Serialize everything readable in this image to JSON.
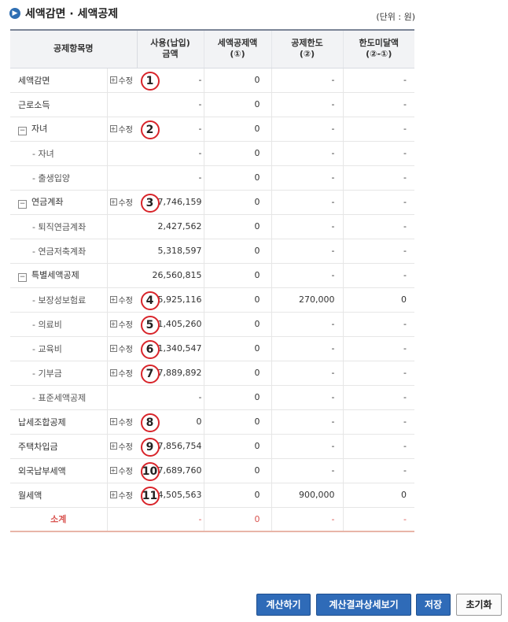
{
  "header": {
    "title": "세액감면 · 세액공제",
    "unit": "(단위 : 원)"
  },
  "columns": {
    "item": "공제항목명",
    "amount": [
      "사용(납입)",
      "금액"
    ],
    "credit": [
      "세액공제액",
      "(①)"
    ],
    "limit": [
      "공제한도",
      "(②)"
    ],
    "shortfall": [
      "한도미달액",
      "(②-①)"
    ]
  },
  "edit_label": "수정",
  "rows": [
    {
      "name": "세액감면",
      "level": "top",
      "edit": true,
      "marker": "1",
      "amount": "-",
      "credit": "0",
      "limit": "-",
      "shortfall": "-"
    },
    {
      "name": "근로소득",
      "level": "top",
      "edit": false,
      "marker": "",
      "amount": "-",
      "credit": "0",
      "limit": "-",
      "shortfall": "-"
    },
    {
      "name": "자녀",
      "level": "group",
      "edit": true,
      "marker": "2",
      "amount": "-",
      "credit": "0",
      "limit": "-",
      "shortfall": "-"
    },
    {
      "name": "- 자녀",
      "level": "sub",
      "edit": false,
      "marker": "",
      "amount": "-",
      "credit": "0",
      "limit": "-",
      "shortfall": "-"
    },
    {
      "name": "- 출생입양",
      "level": "sub",
      "edit": false,
      "marker": "",
      "amount": "-",
      "credit": "0",
      "limit": "-",
      "shortfall": "-"
    },
    {
      "name": "연금계좌",
      "level": "group",
      "edit": true,
      "marker": "3",
      "amount": "7,746,159",
      "credit": "0",
      "limit": "-",
      "shortfall": "-"
    },
    {
      "name": "- 퇴직연금계좌",
      "level": "sub",
      "edit": false,
      "marker": "",
      "amount": "2,427,562",
      "credit": "0",
      "limit": "-",
      "shortfall": "-"
    },
    {
      "name": "- 연금저축계좌",
      "level": "sub",
      "edit": false,
      "marker": "",
      "amount": "5,318,597",
      "credit": "0",
      "limit": "-",
      "shortfall": "-"
    },
    {
      "name": "특별세액공제",
      "level": "group",
      "edit": false,
      "marker": "",
      "amount": "26,560,815",
      "credit": "0",
      "limit": "-",
      "shortfall": "-"
    },
    {
      "name": "- 보장성보험료",
      "level": "sub",
      "edit": true,
      "marker": "4",
      "amount": "5,925,116",
      "credit": "0",
      "limit": "270,000",
      "shortfall": "0"
    },
    {
      "name": "- 의료비",
      "level": "sub",
      "edit": true,
      "marker": "5",
      "amount": "11,405,260",
      "credit": "0",
      "limit": "-",
      "shortfall": "-"
    },
    {
      "name": "- 교육비",
      "level": "sub",
      "edit": true,
      "marker": "6",
      "amount": "1,340,547",
      "credit": "0",
      "limit": "-",
      "shortfall": "-"
    },
    {
      "name": "- 기부금",
      "level": "sub",
      "edit": true,
      "marker": "7",
      "amount": "7,889,892",
      "credit": "0",
      "limit": "-",
      "shortfall": "-"
    },
    {
      "name": "- 표준세액공제",
      "level": "sub",
      "edit": false,
      "marker": "",
      "amount": "-",
      "credit": "0",
      "limit": "-",
      "shortfall": "-"
    },
    {
      "name": "납세조합공제",
      "level": "top",
      "edit": true,
      "marker": "8",
      "amount": "0",
      "credit": "0",
      "limit": "-",
      "shortfall": "-"
    },
    {
      "name": "주택차입금",
      "level": "top",
      "edit": true,
      "marker": "9",
      "amount": "7,856,754",
      "credit": "0",
      "limit": "-",
      "shortfall": "-"
    },
    {
      "name": "외국납부세액",
      "level": "top",
      "edit": true,
      "marker": "10",
      "amount": "87,689,760",
      "credit": "0",
      "limit": "-",
      "shortfall": "-"
    },
    {
      "name": "월세액",
      "level": "top",
      "edit": true,
      "marker": "11",
      "amount": "4,505,563",
      "credit": "0",
      "limit": "900,000",
      "shortfall": "0"
    }
  ],
  "total": {
    "name": "소계",
    "amount": "-",
    "credit": "0",
    "limit": "-",
    "shortfall": "-"
  },
  "buttons": {
    "calculate": "계산하기",
    "detail": "계산결과상세보기",
    "save": "저장",
    "reset": "초기화"
  },
  "colors": {
    "header_border": "#7b8597",
    "button_blue": "#2f6bb8",
    "marker_red": "#d8242a",
    "total_red": "#d9534f"
  }
}
